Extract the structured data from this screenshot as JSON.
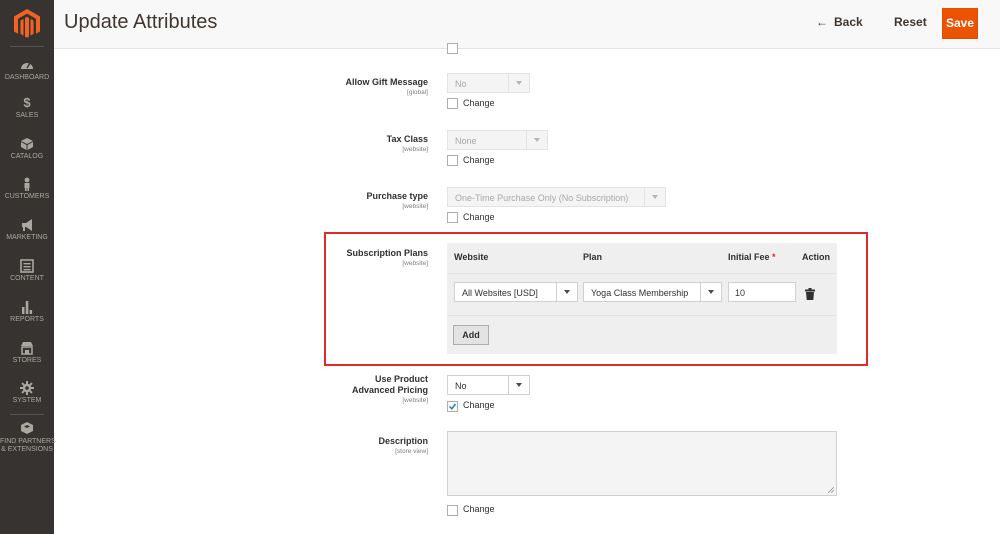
{
  "sidebar": {
    "items": [
      {
        "label": "DASHBOARD",
        "icon": "dashboard-icon"
      },
      {
        "label": "SALES",
        "icon": "dollar-icon"
      },
      {
        "label": "CATALOG",
        "icon": "cube-icon"
      },
      {
        "label": "CUSTOMERS",
        "icon": "person-icon"
      },
      {
        "label": "MARKETING",
        "icon": "megaphone-icon"
      },
      {
        "label": "CONTENT",
        "icon": "content-icon"
      },
      {
        "label": "REPORTS",
        "icon": "bar-chart-icon"
      },
      {
        "label": "STORES",
        "icon": "store-icon"
      },
      {
        "label": "SYSTEM",
        "icon": "gear-icon"
      },
      {
        "label_line1": "FIND PARTNERS",
        "label_line2": "& EXTENSIONS",
        "icon": "partners-icon"
      }
    ]
  },
  "header": {
    "title": "Update Attributes",
    "back_label": "Back",
    "back_arrow": "←",
    "reset_label": "Reset",
    "save_label": "Save"
  },
  "form": {
    "change_label": "Change",
    "gift_message": {
      "label": "Allow Gift Message",
      "scope": "[global]",
      "value": "No",
      "change_checked": false
    },
    "tax_class": {
      "label": "Tax Class",
      "scope": "[website]",
      "value": "None",
      "change_checked": false
    },
    "purchase_type": {
      "label": "Purchase type",
      "scope": "[website]",
      "value": "One-Time Purchase Only (No Subscription)",
      "change_checked": false
    },
    "subscription_plans": {
      "label": "Subscription Plans",
      "scope": "[website]",
      "columns": {
        "website": "Website",
        "plan": "Plan",
        "initial_fee": "Initial Fee",
        "required_mark": "*",
        "action": "Action"
      },
      "rows": [
        {
          "website": "All Websites [USD]",
          "plan": "Yoga Class Membership",
          "initial_fee": "10"
        }
      ],
      "add_label": "Add"
    },
    "advanced_pricing": {
      "label_line1": "Use Product",
      "label_line2": "Advanced Pricing",
      "scope": "[website]",
      "value": "No",
      "change_checked": true
    },
    "description": {
      "label": "Description",
      "scope": "[store view]",
      "value": "",
      "change_checked": false
    }
  },
  "colors": {
    "accent": "#eb5202",
    "sidebar": "#373330",
    "highlight_border": "#e02b27",
    "required": "#e22626"
  }
}
